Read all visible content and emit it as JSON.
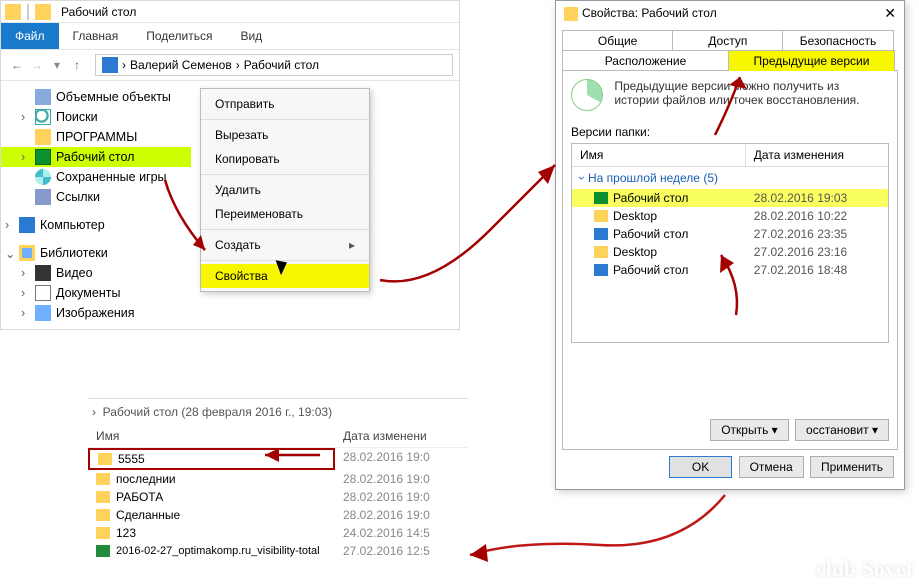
{
  "explorer": {
    "title": "Рабочий стол",
    "ribbon": {
      "file": "Файл",
      "tabs": [
        "Главная",
        "Поделиться",
        "Вид"
      ]
    },
    "breadcrumb": [
      "Валерий Семенов",
      "Рабочий стол"
    ],
    "tree": {
      "favorites_items": [
        {
          "icon": "cube",
          "label": "Объемные объекты",
          "chev": ""
        },
        {
          "icon": "search",
          "label": "Поиски",
          "chev": ">"
        },
        {
          "icon": "folder",
          "label": "ПРОГРАММЫ",
          "chev": ""
        },
        {
          "icon": "desk",
          "label": "Рабочий стол",
          "chev": ">",
          "hl": true
        },
        {
          "icon": "disc",
          "label": "Сохраненные игры",
          "chev": ""
        },
        {
          "icon": "link",
          "label": "Ссылки",
          "chev": ""
        }
      ],
      "computer": {
        "label": "Компьютер",
        "chev": ">"
      },
      "libraries": {
        "label": "Библиотеки",
        "chev": "v",
        "children": [
          {
            "icon": "vid",
            "label": "Видео",
            "chev": ">"
          },
          {
            "icon": "doc",
            "label": "Документы",
            "chev": ">"
          },
          {
            "icon": "img",
            "label": "Изображения",
            "chev": ">"
          }
        ]
      }
    }
  },
  "context_menu": {
    "items": [
      {
        "label": "Отправить"
      },
      {
        "sep": true
      },
      {
        "label": "Вырезать"
      },
      {
        "label": "Копировать"
      },
      {
        "sep": true
      },
      {
        "label": "Удалить"
      },
      {
        "label": "Переименовать"
      },
      {
        "sep": true
      },
      {
        "label": "Создать",
        "arrow": true
      },
      {
        "sep": true
      },
      {
        "label": "Свойства",
        "hl": true
      }
    ]
  },
  "properties": {
    "title": "Свойства: Рабочий стол",
    "close": "✕",
    "tabs_row1": [
      "Общие",
      "Доступ",
      "Безопасность"
    ],
    "tabs_row2": [
      "Расположение",
      "Предыдущие версии"
    ],
    "active_tab": "Предыдущие версии",
    "description": "Предыдущие версии можно получить из истории файлов или точек восстановления.",
    "versions_label": "Версии папки:",
    "columns": [
      "Имя",
      "Дата изменения"
    ],
    "group": "На прошлой неделе (5)",
    "rows": [
      {
        "icon": "desk",
        "name": "Рабочий стол",
        "date": "28.02.2016 19:03",
        "hl": true
      },
      {
        "icon": "fold",
        "name": "Desktop",
        "date": "28.02.2016 10:22"
      },
      {
        "icon": "sys",
        "name": "Рабочий стол",
        "date": "27.02.2016 23:35"
      },
      {
        "icon": "fold",
        "name": "Desktop",
        "date": "27.02.2016 23:16"
      },
      {
        "icon": "sys",
        "name": "Рабочий стол",
        "date": "27.02.2016 18:48"
      }
    ],
    "open_btn": "Открыть",
    "restore_btn": "осстановит",
    "ok": "OK",
    "cancel": "Отмена",
    "apply": "Применить"
  },
  "lower": {
    "crumb": "Рабочий стол (28 февраля 2016 г., 19:03)",
    "columns": [
      "Имя",
      "Дата изменени"
    ],
    "rows": [
      {
        "name": "5555",
        "date": "28.02.2016 19:0",
        "red": true
      },
      {
        "name": "последнии",
        "date": "28.02.2016 19:0"
      },
      {
        "name": "РАБОТА",
        "date": "28.02.2016 19:0"
      },
      {
        "name": "Сделанные",
        "date": "28.02.2016 19:0"
      },
      {
        "name": "123",
        "date": "24.02.2016 14:5"
      },
      {
        "name": "2016-02-27_optimakomp.ru_visibility-total",
        "date": "27.02.2016 12:5",
        "xls": true
      }
    ]
  },
  "watermark": "club Sovet"
}
